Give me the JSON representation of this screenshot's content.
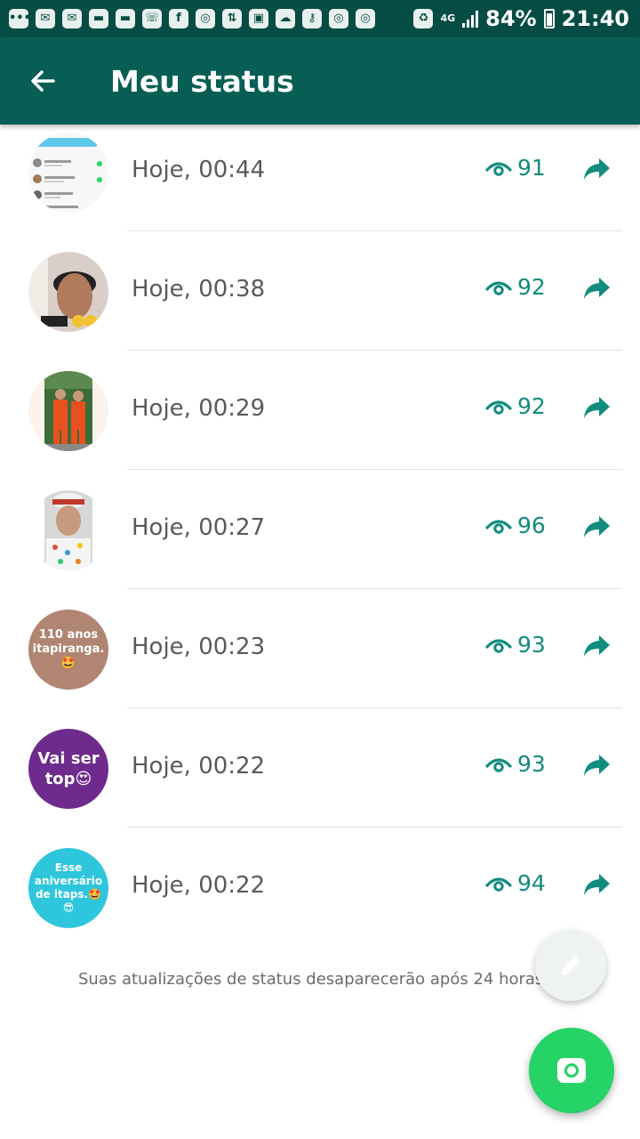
{
  "status_bar": {
    "network": "4G",
    "battery": "84%",
    "time": "21:40"
  },
  "header": {
    "title": "Meu status"
  },
  "statuses": [
    {
      "time": "Hoje, 00:44",
      "views": "91",
      "avatar_text": ""
    },
    {
      "time": "Hoje, 00:38",
      "views": "92",
      "avatar_text": ""
    },
    {
      "time": "Hoje, 00:29",
      "views": "92",
      "avatar_text": ""
    },
    {
      "time": "Hoje, 00:27",
      "views": "96",
      "avatar_text": ""
    },
    {
      "time": "Hoje, 00:23",
      "views": "93",
      "avatar_text": "110 anos itapiranga. 🤩"
    },
    {
      "time": "Hoje, 00:22",
      "views": "93",
      "avatar_text": "Vai ser top😍"
    },
    {
      "time": "Hoje, 00:22",
      "views": "94",
      "avatar_text": "Esse aniversário de itaps.🤩 😎"
    }
  ],
  "footer": {
    "note": "Suas atualizações de status desaparecerão após 24 horas."
  },
  "colors": {
    "status_bar": "#054d44",
    "app_bar": "#075e54",
    "accent": "#128c7e",
    "camera_fab": "#25d366",
    "avatar_brown": "#b08572",
    "avatar_purple": "#6e2a8c",
    "avatar_cyan": "#2ec6dc"
  },
  "icons": [
    "back-arrow-icon",
    "eye-icon",
    "share-arrow-icon",
    "pencil-icon",
    "camera-icon"
  ]
}
